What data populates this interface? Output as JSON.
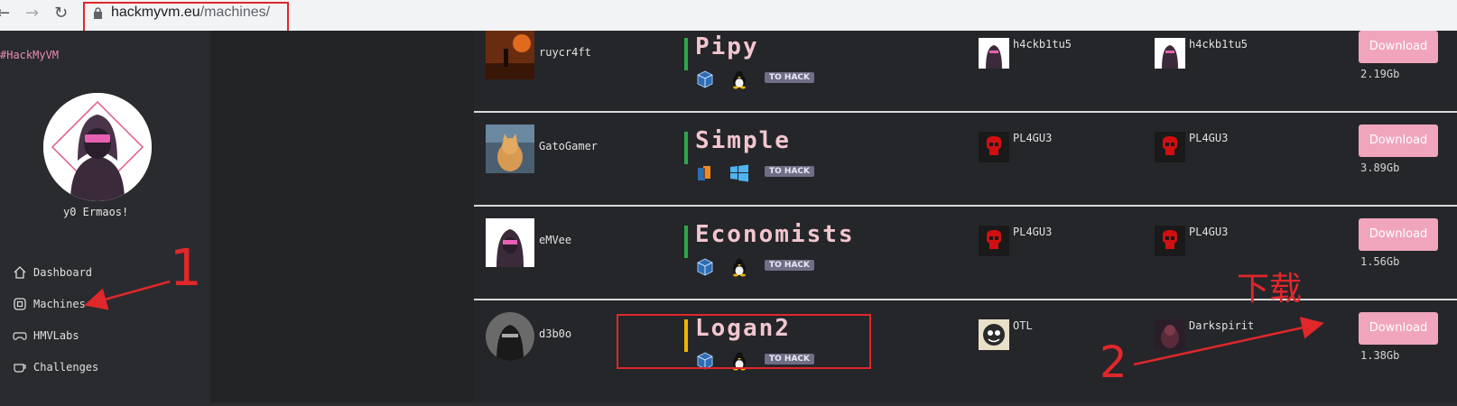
{
  "browser": {
    "url_host": "hackmyvm.eu",
    "url_path": "/machines/"
  },
  "sidebar": {
    "brand": "#HackMyVM",
    "greeting": "y0 Ermaos!",
    "items": [
      {
        "label": "Dashboard",
        "icon": "home-icon"
      },
      {
        "label": "Machines",
        "icon": "chip-icon"
      },
      {
        "label": "HMVLabs",
        "icon": "gamepad-icon"
      },
      {
        "label": "Challenges",
        "icon": "cup-icon"
      }
    ]
  },
  "machines": [
    {
      "creator": "ruycr4ft",
      "name": "Pipy",
      "bar_color": "#2ea84a",
      "os": [
        "virtualbox-icon",
        "linux-icon"
      ],
      "status": "TO HACK",
      "first_user": "h4ckb1tu5",
      "first_root": "h4ckb1tu5",
      "download": "Download",
      "size": "2.19Gb"
    },
    {
      "creator": "GatoGamer",
      "name": "Simple",
      "bar_color": "#2ea84a",
      "os": [
        "vmware-icon",
        "windows-icon"
      ],
      "status": "TO HACK",
      "first_user": "PL4GU3",
      "first_root": "PL4GU3",
      "download": "Download",
      "size": "3.89Gb"
    },
    {
      "creator": "eMVee",
      "name": "Economists",
      "bar_color": "#2ea84a",
      "os": [
        "virtualbox-icon",
        "linux-icon"
      ],
      "status": "TO HACK",
      "first_user": "PL4GU3",
      "first_root": "PL4GU3",
      "download": "Download",
      "size": "1.56Gb"
    },
    {
      "creator": "d3b0o",
      "name": "Logan2",
      "bar_color": "#f0b400",
      "os": [
        "virtualbox-icon",
        "linux-icon"
      ],
      "status": "TO HACK",
      "first_user": "OTL",
      "first_root": "Darkspirit",
      "download": "Download",
      "size": "1.38Gb"
    }
  ],
  "annotations": {
    "step1": "1",
    "step2": "2",
    "download_note": "下载",
    "color": "#e0272b"
  }
}
